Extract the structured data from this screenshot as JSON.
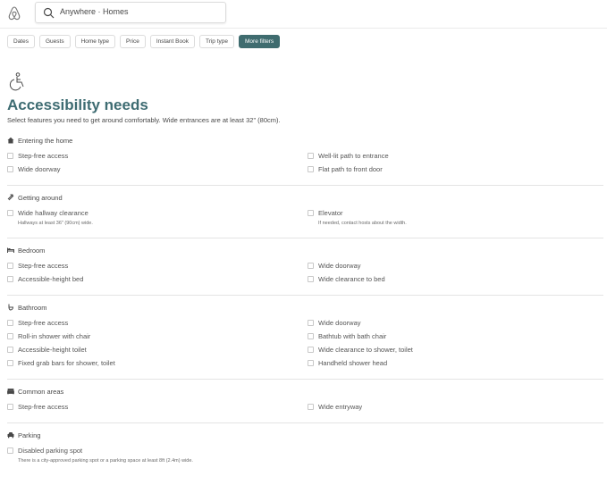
{
  "search": {
    "text": "Anywhere · Homes"
  },
  "filters": [
    "Dates",
    "Guests",
    "Home type",
    "Price",
    "Instant Book",
    "Trip type",
    "More filters"
  ],
  "header": {
    "title": "Accessibility needs",
    "subtitle": "Select features you need to get around comfortably. Wide entrances are at least 32\" (80cm)."
  },
  "colors": {
    "accent": "#3e6c72",
    "active_pill": "#3f6c6f"
  },
  "sections": [
    {
      "title": "Entering the home",
      "icon": "home-icon",
      "left": [
        {
          "label": "Step-free access"
        },
        {
          "label": "Wide doorway"
        }
      ],
      "right": [
        {
          "label": "Well-lit path to entrance"
        },
        {
          "label": "Flat path to front door"
        }
      ]
    },
    {
      "title": "Getting around",
      "icon": "arrows-icon",
      "left": [
        {
          "label": "Wide hallway clearance",
          "note": "Hallways at least 36\" (90cm) wide."
        }
      ],
      "right": [
        {
          "label": "Elevator",
          "note": "If needed, contact hosts about the width."
        }
      ]
    },
    {
      "title": "Bedroom",
      "icon": "bed-icon",
      "left": [
        {
          "label": "Step-free access"
        },
        {
          "label": "Accessible-height bed"
        }
      ],
      "right": [
        {
          "label": "Wide doorway"
        },
        {
          "label": "Wide clearance to bed"
        }
      ]
    },
    {
      "title": "Bathroom",
      "icon": "toilet-icon",
      "left": [
        {
          "label": "Step-free access"
        },
        {
          "label": "Roll-in shower with chair"
        },
        {
          "label": "Accessible-height toilet"
        },
        {
          "label": "Fixed grab bars for shower, toilet"
        }
      ],
      "right": [
        {
          "label": "Wide doorway"
        },
        {
          "label": "Bathtub with bath chair"
        },
        {
          "label": "Wide clearance to shower, toilet"
        },
        {
          "label": "Handheld shower head"
        }
      ]
    },
    {
      "title": "Common areas",
      "icon": "sofa-icon",
      "left": [
        {
          "label": "Step-free access"
        }
      ],
      "right": [
        {
          "label": "Wide entryway"
        }
      ]
    },
    {
      "title": "Parking",
      "icon": "car-icon",
      "left": [
        {
          "label": "Disabled parking spot",
          "note": "There is a city-approved parking spot or a parking space at least 8ft (2.4m) wide."
        }
      ],
      "right": []
    }
  ]
}
